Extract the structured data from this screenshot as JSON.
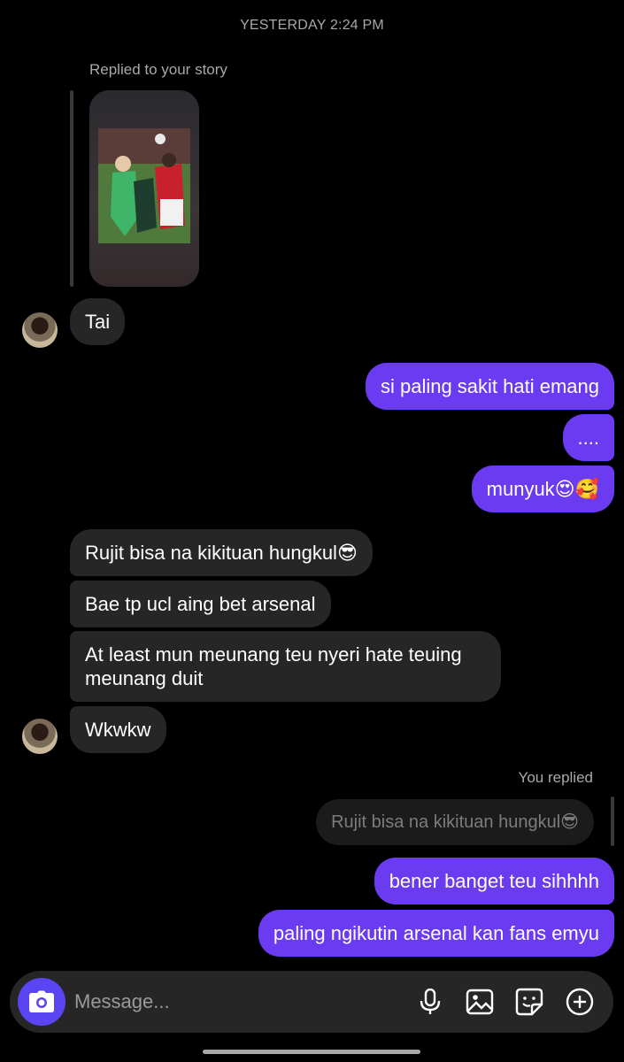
{
  "header": {
    "timestamp": "YESTERDAY 2:24 PM"
  },
  "story_reply": {
    "label": "Replied to your story"
  },
  "messages": [
    {
      "from": "them",
      "text": "Tai"
    },
    {
      "from": "me",
      "text": "si paling sakit hati emang"
    },
    {
      "from": "me",
      "text": "...."
    },
    {
      "from": "me",
      "text": "munyuk😍🥰"
    },
    {
      "from": "them",
      "text": "Rujit bisa na kikituan hungkul😎"
    },
    {
      "from": "them",
      "text": "Bae tp ucl aing bet arsenal"
    },
    {
      "from": "them",
      "text": "At least mun meunang teu nyeri hate teuing meunang duit"
    },
    {
      "from": "them",
      "text": "Wkwkw"
    },
    {
      "from": "me",
      "text": "bener banget teu sihhhh"
    },
    {
      "from": "me",
      "text": "paling ngikutin arsenal kan fans emyu"
    }
  ],
  "reply_context": {
    "label": "You replied",
    "quoted_text": "Rujit bisa na kikituan hungkul😎"
  },
  "composer": {
    "placeholder": "Message..."
  },
  "icons": {
    "camera": "camera-icon",
    "mic": "microphone-icon",
    "gallery": "image-icon",
    "sticker": "sticker-icon",
    "add": "plus-circle-icon"
  },
  "colors": {
    "outgoing_bubble": "#6a3bf0",
    "incoming_bubble": "#262626",
    "camera_button": "#5b45f2",
    "background": "#000000"
  }
}
